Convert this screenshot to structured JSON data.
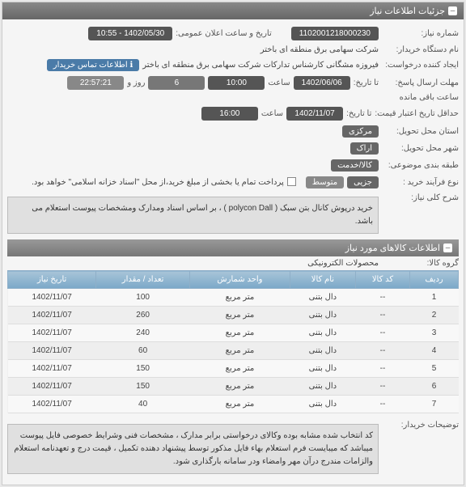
{
  "panel_title": "جزئیات اطلاعات نیاز",
  "fields": {
    "need_number_lbl": "شماره نیاز:",
    "need_number": "1102001218000230",
    "announce_lbl": "تاریخ و ساعت اعلان عمومی:",
    "announce_val": "1402/05/30 - 10:55",
    "buyer_lbl": "نام دستگاه خریدار:",
    "buyer_val": "شرکت سهامی برق منطقه ای باختر",
    "creator_lbl": "ایجاد کننده درخواست:",
    "creator_val": "فیروزه مشگانی کارشناس تدارکات شرکت سهامی برق منطقه ای باختر",
    "contact_lbl": "اطلاعات تماس خریدار",
    "deadline_lbl": "مهلت ارسال پاسخ:",
    "deadline_prefix": "تا تاریخ:",
    "deadline_date": "1402/06/06",
    "deadline_time_lbl": "ساعت",
    "deadline_time": "10:00",
    "day_word": "روز و",
    "days_val": "6",
    "remain_time": "22:57:21",
    "remain_lbl": "ساعت باقی مانده",
    "validity_lbl": "حداقل تاریخ اعتبار قیمت:",
    "validity_prefix": "تا تاریخ:",
    "validity_date": "1402/11/07",
    "validity_time_lbl": "ساعت",
    "validity_time": "16:00",
    "province_lbl": "استان محل تحویل:",
    "province_val": "مرکزی",
    "city_lbl": "شهر محل تحویل:",
    "city_val": "اراک",
    "topic_lbl": "طبقه بندی موضوعی:",
    "topic_val": "کالا/خدمت",
    "process_lbl": "نوع فرآیند خرید :",
    "process_val": "جزیی",
    "process_val2": "متوسط",
    "payment_note": "پرداخت تمام یا بخشی از مبلغ خرید،از محل \"اسناد خزانه اسلامی\" خواهد بود.",
    "need_desc_lbl": "شرح کلی نیاز:",
    "need_desc": "خرید درپوش کانال بتن سبک ( polycon Dall ) ، بر اساس اسناد ومدارک ومشخصات پیوست استعلام می باشد.",
    "items_header": "اطلاعات کالاهای مورد نیاز",
    "group_lbl": "گروه کالا:",
    "group_val": "محصولات الکترونیکی",
    "buyer_notes_lbl": "توضیحات خریدار:",
    "buyer_notes": "کد انتخاب شده مشابه بوده وکالای درخواستی برابر مدارک ، مشخصات فنی وشرایط خصوصی فایل پیوست میباشد که میبایست فرم استعلام بهاء فایل مذکور توسط پیشنهاد دهنده تکمیل ، قیمت درج و تعهدنامه استعلام والزامات  مندرج درآن مهر وامضاء ودر سامانه بارگذاری شود."
  },
  "table": {
    "headers": [
      "ردیف",
      "کد کالا",
      "نام کالا",
      "واحد شمارش",
      "تعداد / مقدار",
      "تاریخ نیاز"
    ],
    "rows": [
      [
        "1",
        "--",
        "دال بتنی",
        "متر مربع",
        "100",
        "1402/11/07"
      ],
      [
        "2",
        "--",
        "دال بتنی",
        "متر مربع",
        "260",
        "1402/11/07"
      ],
      [
        "3",
        "--",
        "دال بتنی",
        "متر مربع",
        "240",
        "1402/11/07"
      ],
      [
        "4",
        "--",
        "دال بتنی",
        "متر مربع",
        "60",
        "1402/11/07"
      ],
      [
        "5",
        "--",
        "دال بتنی",
        "متر مربع",
        "150",
        "1402/11/07"
      ],
      [
        "6",
        "--",
        "دال بتنی",
        "متر مربع",
        "150",
        "1402/11/07"
      ],
      [
        "7",
        "--",
        "دال بتنی",
        "متر مربع",
        "40",
        "1402/11/07"
      ]
    ]
  }
}
